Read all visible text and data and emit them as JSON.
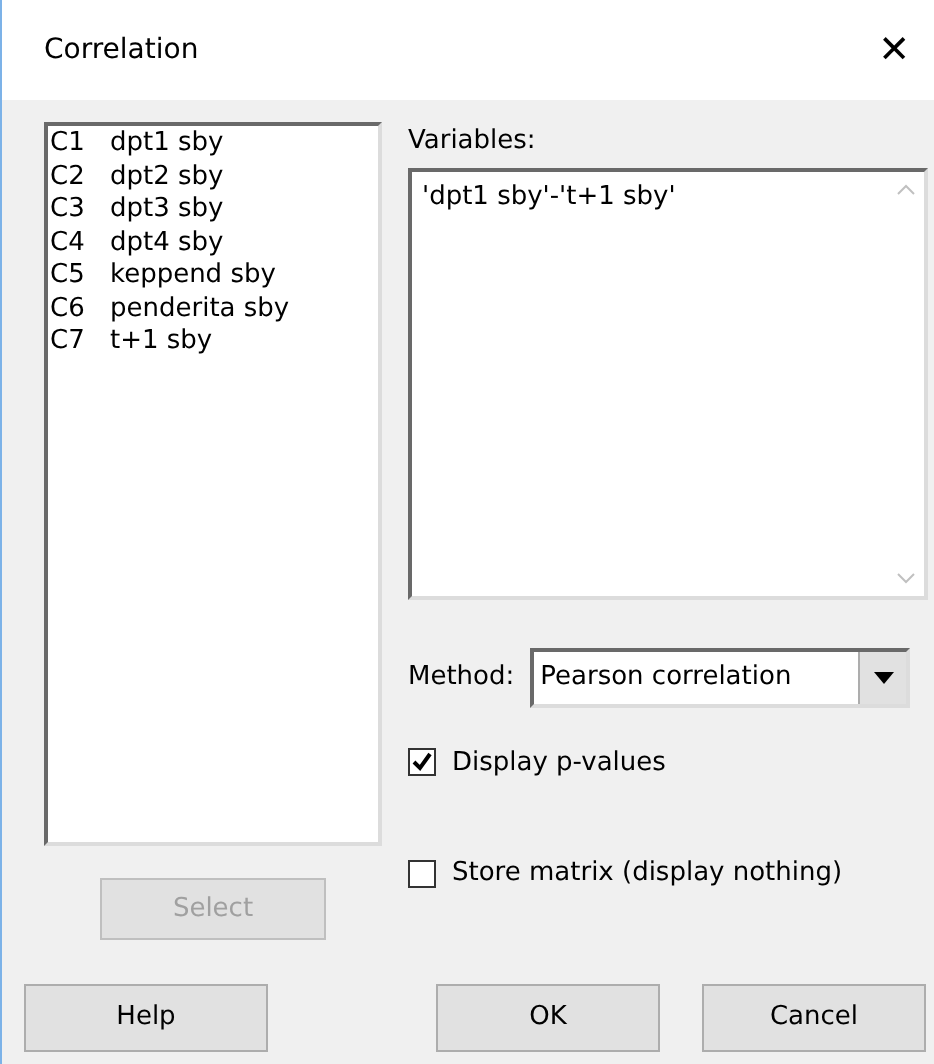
{
  "window": {
    "title": "Correlation",
    "close": "✕"
  },
  "columns": [
    {
      "id": "C1",
      "name": "dpt1 sby"
    },
    {
      "id": "C2",
      "name": "dpt2 sby"
    },
    {
      "id": "C3",
      "name": "dpt3 sby"
    },
    {
      "id": "C4",
      "name": "dpt4 sby"
    },
    {
      "id": "C5",
      "name": "keppend sby"
    },
    {
      "id": "C6",
      "name": "penderita sby"
    },
    {
      "id": "C7",
      "name": "t+1 sby"
    }
  ],
  "select_button": {
    "label": "Select",
    "disabled": true
  },
  "variables": {
    "label": "Variables:",
    "value": "'dpt1 sby'-'t+1 sby'"
  },
  "method": {
    "label": "Method:",
    "value": "Pearson correlation"
  },
  "options": [
    {
      "label": "Display p-values",
      "checked": true
    },
    {
      "label": "Store matrix (display nothing)",
      "checked": false
    }
  ],
  "buttons": [
    {
      "label": "Help"
    },
    {
      "label": "OK"
    },
    {
      "label": "Cancel"
    }
  ]
}
